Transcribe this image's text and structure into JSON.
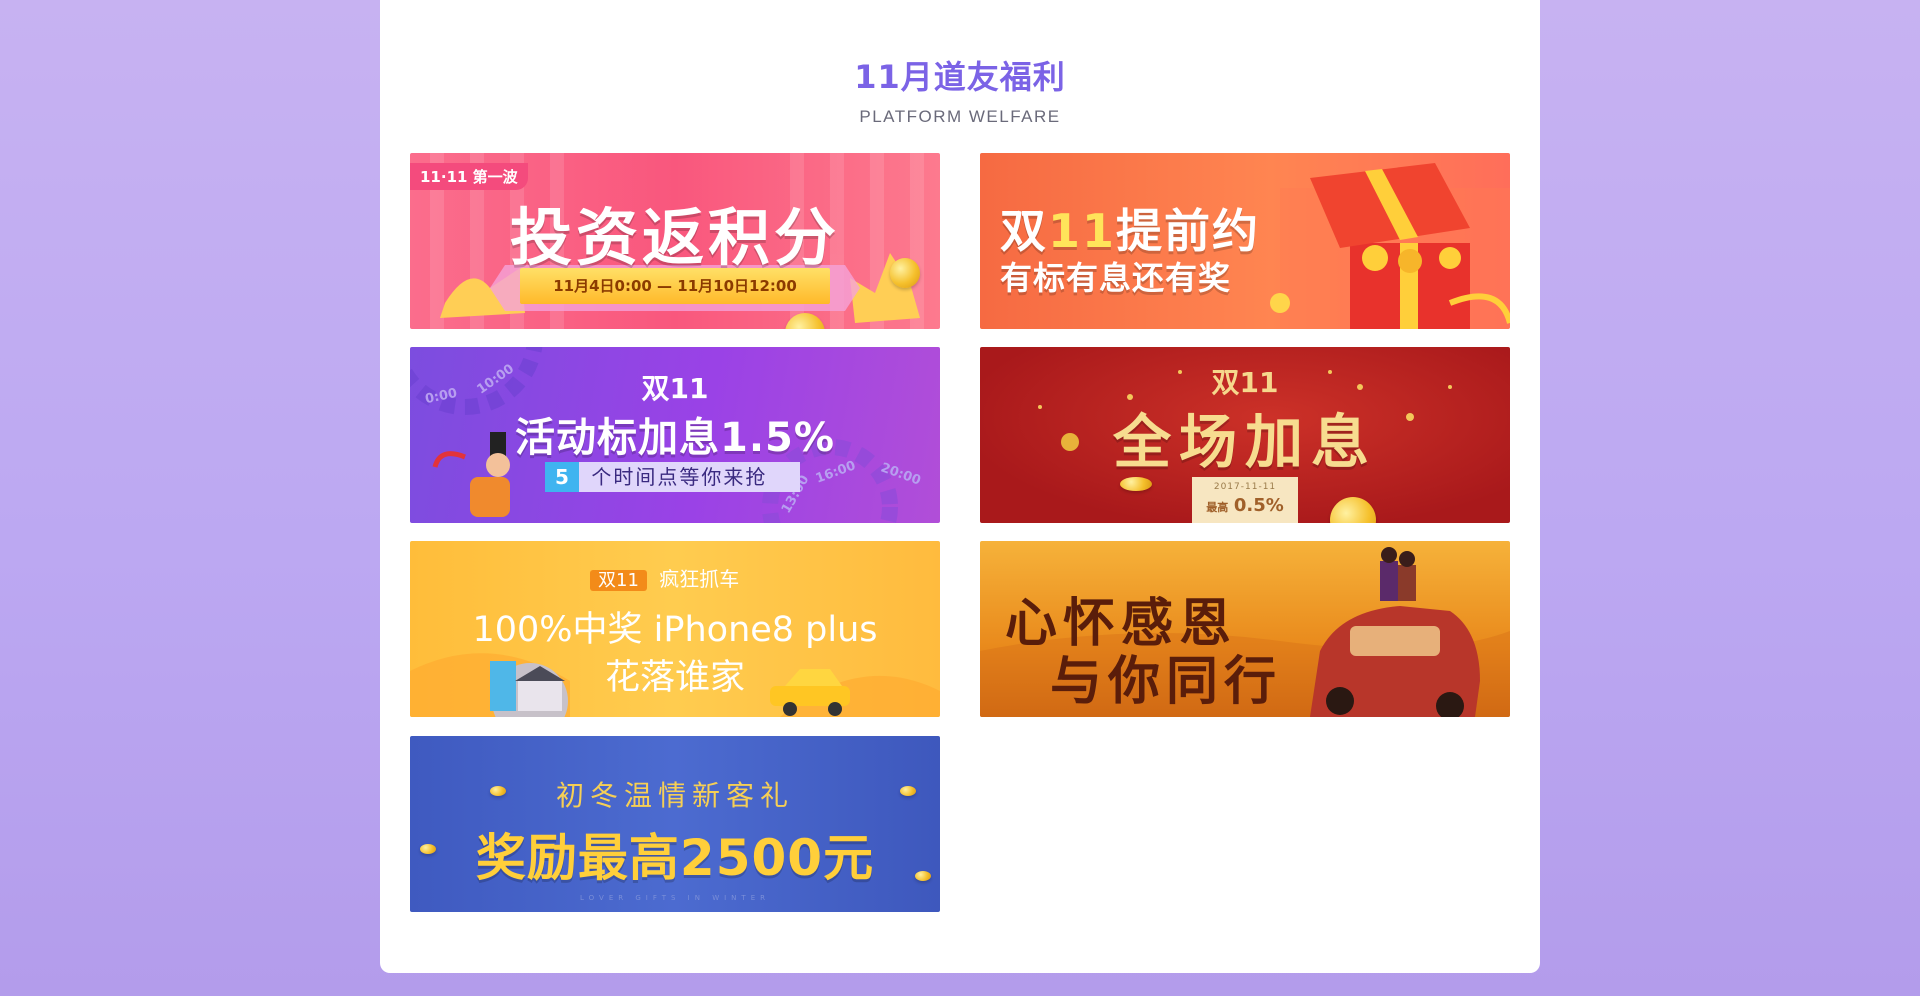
{
  "header": {
    "title": "11月道友福利",
    "subtitle": "PLATFORM WELFARE"
  },
  "banners": [
    {
      "tag": "11·11 第一波",
      "headline": "投资返积分",
      "dates": "11月4日0:00 — 11月10日12:00"
    },
    {
      "line1_a": "双",
      "line1_b": "11",
      "line1_c": "提前约",
      "line2": "有标有息还有奖"
    },
    {
      "badge": "双11",
      "headline": "活动标加息1.5%",
      "count": "5",
      "subline": "个时间点等你来抢",
      "times": [
        "0:00",
        "10:00",
        "13:00",
        "16:00",
        "20:00"
      ]
    },
    {
      "badge": "双11",
      "headline": "全场加息",
      "date": "2017-11-11",
      "max_label": "最高",
      "max_value": "0.5%"
    },
    {
      "badge": "双11",
      "badge_text": "疯狂抓车",
      "line1": "100%中奖 iPhone8 plus",
      "line2": "花落谁家"
    },
    {
      "line1": "心怀感恩",
      "line2": "与你同行"
    },
    {
      "line1": "初冬温情新客礼",
      "headline": "奖励最高2500元",
      "fine": "LOVER GIFTS IN WINTER"
    }
  ]
}
